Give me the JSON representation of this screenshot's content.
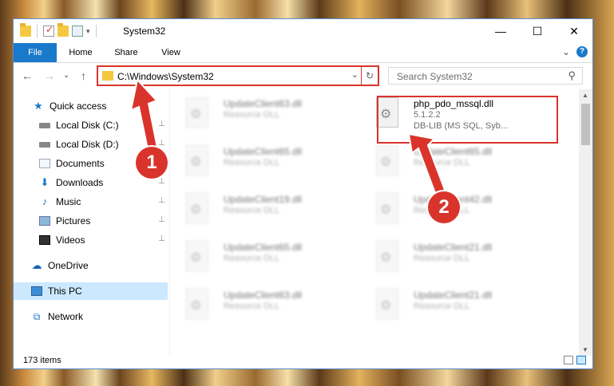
{
  "window": {
    "title": "System32",
    "controls": {
      "minimize": "—",
      "maximize": "☐",
      "close": "✕"
    }
  },
  "ribbon": {
    "tabs": [
      "File",
      "Home",
      "Share",
      "View"
    ],
    "expand": "⌄",
    "help": "?"
  },
  "nav": {
    "back": "←",
    "forward": "→",
    "recent": "⌄",
    "up": "↑",
    "address": "C:\\Windows\\System32",
    "address_chevron": "⌄",
    "refresh": "↻",
    "search_placeholder": "Search System32",
    "search_icon": "⚲"
  },
  "sidebar": {
    "items": [
      {
        "label": "Quick access",
        "icon": "star-icon",
        "pinned": false
      },
      {
        "label": "Local Disk (C:)",
        "icon": "disk-icon",
        "pinned": true
      },
      {
        "label": "Local Disk (D:)",
        "icon": "disk-icon",
        "pinned": true
      },
      {
        "label": "Documents",
        "icon": "document-icon",
        "pinned": true
      },
      {
        "label": "Downloads",
        "icon": "download-icon",
        "pinned": true
      },
      {
        "label": "Music",
        "icon": "music-icon",
        "pinned": true
      },
      {
        "label": "Pictures",
        "icon": "picture-icon",
        "pinned": true
      },
      {
        "label": "Videos",
        "icon": "video-icon",
        "pinned": true
      },
      {
        "label": "OneDrive",
        "icon": "cloud-icon",
        "pinned": false
      },
      {
        "label": "This PC",
        "icon": "computer-icon",
        "pinned": false,
        "selected": true
      },
      {
        "label": "Network",
        "icon": "network-icon",
        "pinned": false
      }
    ],
    "pin_glyph": "📌"
  },
  "files": {
    "left_column": [
      {
        "name": "UpdateClient63.dll",
        "type": "Resource DLL"
      },
      {
        "name": "UpdateClient65.dll",
        "type": "Resource DLL"
      },
      {
        "name": "UpdateClient19.dll",
        "type": "Resource DLL"
      },
      {
        "name": "UpdateClient65.dll",
        "type": "Resource DLL"
      },
      {
        "name": "UpdateClient63.dll",
        "type": "Resource DLL"
      }
    ],
    "right_column": [
      {
        "name": "php_pdo_mssql.dll",
        "version": "5.1.2.2",
        "description": "DB-LIB (MS SQL, Syb..."
      },
      {
        "name": "UpdateClient65.dll",
        "type": "Resource DLL"
      },
      {
        "name": "UpdateClient42.dll",
        "type": "Resource DLL"
      },
      {
        "name": "UpdateClient21.dll",
        "type": "Resource DLL"
      },
      {
        "name": "UpdateClient21.dll",
        "type": "Resource DLL"
      }
    ]
  },
  "status": {
    "item_count": "173 items"
  },
  "annotations": {
    "marker_1": "1",
    "marker_2": "2",
    "color": "#d9342b"
  }
}
